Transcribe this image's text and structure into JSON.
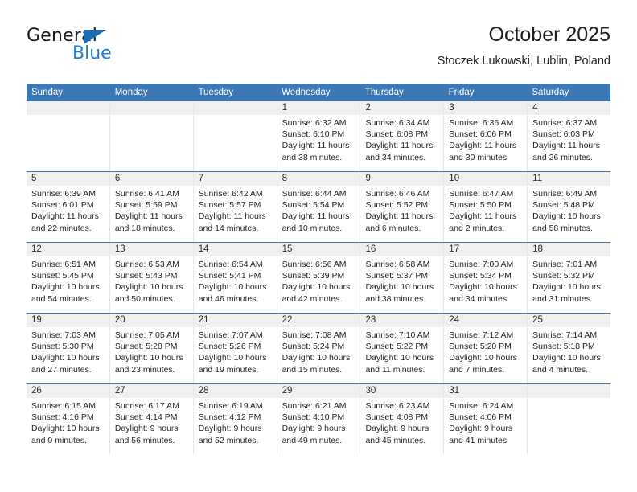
{
  "brand": {
    "name_top": "General",
    "name_bottom": "Blue",
    "triangle_color": "#1b6cb0",
    "blue_color": "#1b7fd4"
  },
  "header": {
    "title": "October 2025",
    "subtitle": "Stoczek Lukowski, Lublin, Poland"
  },
  "theme": {
    "header_blue": "#3b78b5",
    "day_strip_gray": "#f0f0f0",
    "text": "#222222"
  },
  "weekdays": [
    "Sunday",
    "Monday",
    "Tuesday",
    "Wednesday",
    "Thursday",
    "Friday",
    "Saturday"
  ],
  "labels": {
    "sunrise": "Sunrise:",
    "sunset": "Sunset:",
    "daylight": "Daylight:"
  },
  "weeks": [
    [
      {
        "day": "",
        "sunrise": "",
        "sunset": "",
        "daylight_1": "",
        "daylight_2": ""
      },
      {
        "day": "",
        "sunrise": "",
        "sunset": "",
        "daylight_1": "",
        "daylight_2": ""
      },
      {
        "day": "",
        "sunrise": "",
        "sunset": "",
        "daylight_1": "",
        "daylight_2": ""
      },
      {
        "day": "1",
        "sunrise": "Sunrise: 6:32 AM",
        "sunset": "Sunset: 6:10 PM",
        "daylight_1": "Daylight: 11 hours",
        "daylight_2": "and 38 minutes."
      },
      {
        "day": "2",
        "sunrise": "Sunrise: 6:34 AM",
        "sunset": "Sunset: 6:08 PM",
        "daylight_1": "Daylight: 11 hours",
        "daylight_2": "and 34 minutes."
      },
      {
        "day": "3",
        "sunrise": "Sunrise: 6:36 AM",
        "sunset": "Sunset: 6:06 PM",
        "daylight_1": "Daylight: 11 hours",
        "daylight_2": "and 30 minutes."
      },
      {
        "day": "4",
        "sunrise": "Sunrise: 6:37 AM",
        "sunset": "Sunset: 6:03 PM",
        "daylight_1": "Daylight: 11 hours",
        "daylight_2": "and 26 minutes."
      }
    ],
    [
      {
        "day": "5",
        "sunrise": "Sunrise: 6:39 AM",
        "sunset": "Sunset: 6:01 PM",
        "daylight_1": "Daylight: 11 hours",
        "daylight_2": "and 22 minutes."
      },
      {
        "day": "6",
        "sunrise": "Sunrise: 6:41 AM",
        "sunset": "Sunset: 5:59 PM",
        "daylight_1": "Daylight: 11 hours",
        "daylight_2": "and 18 minutes."
      },
      {
        "day": "7",
        "sunrise": "Sunrise: 6:42 AM",
        "sunset": "Sunset: 5:57 PM",
        "daylight_1": "Daylight: 11 hours",
        "daylight_2": "and 14 minutes."
      },
      {
        "day": "8",
        "sunrise": "Sunrise: 6:44 AM",
        "sunset": "Sunset: 5:54 PM",
        "daylight_1": "Daylight: 11 hours",
        "daylight_2": "and 10 minutes."
      },
      {
        "day": "9",
        "sunrise": "Sunrise: 6:46 AM",
        "sunset": "Sunset: 5:52 PM",
        "daylight_1": "Daylight: 11 hours",
        "daylight_2": "and 6 minutes."
      },
      {
        "day": "10",
        "sunrise": "Sunrise: 6:47 AM",
        "sunset": "Sunset: 5:50 PM",
        "daylight_1": "Daylight: 11 hours",
        "daylight_2": "and 2 minutes."
      },
      {
        "day": "11",
        "sunrise": "Sunrise: 6:49 AM",
        "sunset": "Sunset: 5:48 PM",
        "daylight_1": "Daylight: 10 hours",
        "daylight_2": "and 58 minutes."
      }
    ],
    [
      {
        "day": "12",
        "sunrise": "Sunrise: 6:51 AM",
        "sunset": "Sunset: 5:45 PM",
        "daylight_1": "Daylight: 10 hours",
        "daylight_2": "and 54 minutes."
      },
      {
        "day": "13",
        "sunrise": "Sunrise: 6:53 AM",
        "sunset": "Sunset: 5:43 PM",
        "daylight_1": "Daylight: 10 hours",
        "daylight_2": "and 50 minutes."
      },
      {
        "day": "14",
        "sunrise": "Sunrise: 6:54 AM",
        "sunset": "Sunset: 5:41 PM",
        "daylight_1": "Daylight: 10 hours",
        "daylight_2": "and 46 minutes."
      },
      {
        "day": "15",
        "sunrise": "Sunrise: 6:56 AM",
        "sunset": "Sunset: 5:39 PM",
        "daylight_1": "Daylight: 10 hours",
        "daylight_2": "and 42 minutes."
      },
      {
        "day": "16",
        "sunrise": "Sunrise: 6:58 AM",
        "sunset": "Sunset: 5:37 PM",
        "daylight_1": "Daylight: 10 hours",
        "daylight_2": "and 38 minutes."
      },
      {
        "day": "17",
        "sunrise": "Sunrise: 7:00 AM",
        "sunset": "Sunset: 5:34 PM",
        "daylight_1": "Daylight: 10 hours",
        "daylight_2": "and 34 minutes."
      },
      {
        "day": "18",
        "sunrise": "Sunrise: 7:01 AM",
        "sunset": "Sunset: 5:32 PM",
        "daylight_1": "Daylight: 10 hours",
        "daylight_2": "and 31 minutes."
      }
    ],
    [
      {
        "day": "19",
        "sunrise": "Sunrise: 7:03 AM",
        "sunset": "Sunset: 5:30 PM",
        "daylight_1": "Daylight: 10 hours",
        "daylight_2": "and 27 minutes."
      },
      {
        "day": "20",
        "sunrise": "Sunrise: 7:05 AM",
        "sunset": "Sunset: 5:28 PM",
        "daylight_1": "Daylight: 10 hours",
        "daylight_2": "and 23 minutes."
      },
      {
        "day": "21",
        "sunrise": "Sunrise: 7:07 AM",
        "sunset": "Sunset: 5:26 PM",
        "daylight_1": "Daylight: 10 hours",
        "daylight_2": "and 19 minutes."
      },
      {
        "day": "22",
        "sunrise": "Sunrise: 7:08 AM",
        "sunset": "Sunset: 5:24 PM",
        "daylight_1": "Daylight: 10 hours",
        "daylight_2": "and 15 minutes."
      },
      {
        "day": "23",
        "sunrise": "Sunrise: 7:10 AM",
        "sunset": "Sunset: 5:22 PM",
        "daylight_1": "Daylight: 10 hours",
        "daylight_2": "and 11 minutes."
      },
      {
        "day": "24",
        "sunrise": "Sunrise: 7:12 AM",
        "sunset": "Sunset: 5:20 PM",
        "daylight_1": "Daylight: 10 hours",
        "daylight_2": "and 7 minutes."
      },
      {
        "day": "25",
        "sunrise": "Sunrise: 7:14 AM",
        "sunset": "Sunset: 5:18 PM",
        "daylight_1": "Daylight: 10 hours",
        "daylight_2": "and 4 minutes."
      }
    ],
    [
      {
        "day": "26",
        "sunrise": "Sunrise: 6:15 AM",
        "sunset": "Sunset: 4:16 PM",
        "daylight_1": "Daylight: 10 hours",
        "daylight_2": "and 0 minutes."
      },
      {
        "day": "27",
        "sunrise": "Sunrise: 6:17 AM",
        "sunset": "Sunset: 4:14 PM",
        "daylight_1": "Daylight: 9 hours",
        "daylight_2": "and 56 minutes."
      },
      {
        "day": "28",
        "sunrise": "Sunrise: 6:19 AM",
        "sunset": "Sunset: 4:12 PM",
        "daylight_1": "Daylight: 9 hours",
        "daylight_2": "and 52 minutes."
      },
      {
        "day": "29",
        "sunrise": "Sunrise: 6:21 AM",
        "sunset": "Sunset: 4:10 PM",
        "daylight_1": "Daylight: 9 hours",
        "daylight_2": "and 49 minutes."
      },
      {
        "day": "30",
        "sunrise": "Sunrise: 6:23 AM",
        "sunset": "Sunset: 4:08 PM",
        "daylight_1": "Daylight: 9 hours",
        "daylight_2": "and 45 minutes."
      },
      {
        "day": "31",
        "sunrise": "Sunrise: 6:24 AM",
        "sunset": "Sunset: 4:06 PM",
        "daylight_1": "Daylight: 9 hours",
        "daylight_2": "and 41 minutes."
      },
      {
        "day": "",
        "sunrise": "",
        "sunset": "",
        "daylight_1": "",
        "daylight_2": ""
      }
    ]
  ]
}
